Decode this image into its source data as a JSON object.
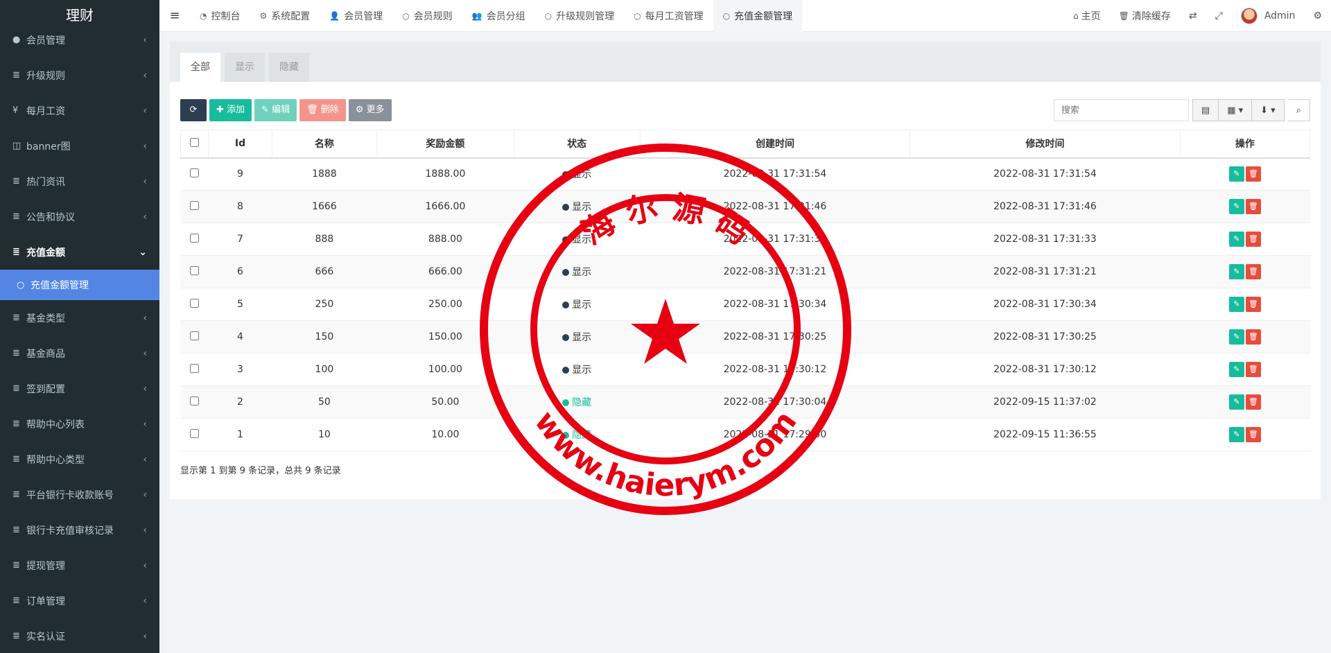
{
  "sidebar": {
    "brand": "理财",
    "items": [
      {
        "icon": "user-circle-icon",
        "glyph": "●",
        "label": "会员管理"
      },
      {
        "icon": "list-icon",
        "glyph": "≣",
        "label": "升级规则"
      },
      {
        "icon": "yen-icon",
        "glyph": "¥",
        "label": "每月工资"
      },
      {
        "icon": "columns-icon",
        "glyph": "◫",
        "label": "banner图"
      },
      {
        "icon": "list-icon",
        "glyph": "≣",
        "label": "热门资讯"
      },
      {
        "icon": "list-icon",
        "glyph": "≣",
        "label": "公告和协议"
      },
      {
        "icon": "list-icon",
        "glyph": "≣",
        "label": "充值金额"
      },
      {
        "icon": "circle-icon",
        "glyph": "○",
        "label": "充值金额管理"
      },
      {
        "icon": "list-icon",
        "glyph": "≣",
        "label": "基金类型"
      },
      {
        "icon": "list-icon",
        "glyph": "≣",
        "label": "基金商品"
      },
      {
        "icon": "list-icon",
        "glyph": "≣",
        "label": "签到配置"
      },
      {
        "icon": "list-icon",
        "glyph": "≣",
        "label": "帮助中心列表"
      },
      {
        "icon": "list-icon",
        "glyph": "≣",
        "label": "帮助中心类型"
      },
      {
        "icon": "list-icon",
        "glyph": "≣",
        "label": "平台银行卡收款账号"
      },
      {
        "icon": "list-icon",
        "glyph": "≣",
        "label": "银行卡充值审核记录"
      },
      {
        "icon": "list-icon",
        "glyph": "≣",
        "label": "提现管理"
      },
      {
        "icon": "list-icon",
        "glyph": "≣",
        "label": "订单管理"
      },
      {
        "icon": "list-icon",
        "glyph": "≣",
        "label": "实名认证"
      }
    ]
  },
  "topnav": {
    "tabs": [
      {
        "icon": "dashboard-icon",
        "label": "控制台"
      },
      {
        "icon": "gear-icon",
        "label": "系统配置"
      },
      {
        "icon": "user-icon",
        "label": "会员管理"
      },
      {
        "icon": "circle-icon",
        "label": "会员规则"
      },
      {
        "icon": "users-icon",
        "label": "会员分组"
      },
      {
        "icon": "circle-icon",
        "label": "升级规则管理"
      },
      {
        "icon": "circle-icon",
        "label": "每月工资管理"
      },
      {
        "icon": "circle-icon",
        "label": "充值金额管理"
      }
    ],
    "right": {
      "home": "主页",
      "clear_cache": "清除缓存",
      "user": "Admin"
    }
  },
  "panel": {
    "filter_tabs": [
      "全部",
      "显示",
      "隐藏"
    ],
    "toolbar": {
      "add": "添加",
      "edit": "编辑",
      "delete": "删除",
      "more": "更多"
    },
    "search_placeholder": "搜索",
    "columns": [
      "Id",
      "名称",
      "奖励金额",
      "状态",
      "创建时间",
      "修改时间",
      "操作"
    ],
    "rows": [
      {
        "id": "9",
        "name": "1888",
        "amount": "1888.00",
        "status": "显示",
        "status_type": "show",
        "created": "2022-08-31 17:31:54",
        "updated": "2022-08-31 17:31:54"
      },
      {
        "id": "8",
        "name": "1666",
        "amount": "1666.00",
        "status": "显示",
        "status_type": "show",
        "created": "2022-08-31 17:31:46",
        "updated": "2022-08-31 17:31:46"
      },
      {
        "id": "7",
        "name": "888",
        "amount": "888.00",
        "status": "显示",
        "status_type": "show",
        "created": "2022-08-31 17:31:33",
        "updated": "2022-08-31 17:31:33"
      },
      {
        "id": "6",
        "name": "666",
        "amount": "666.00",
        "status": "显示",
        "status_type": "show",
        "created": "2022-08-31 17:31:21",
        "updated": "2022-08-31 17:31:21"
      },
      {
        "id": "5",
        "name": "250",
        "amount": "250.00",
        "status": "显示",
        "status_type": "show",
        "created": "2022-08-31 17:30:34",
        "updated": "2022-08-31 17:30:34"
      },
      {
        "id": "4",
        "name": "150",
        "amount": "150.00",
        "status": "显示",
        "status_type": "show",
        "created": "2022-08-31 17:30:25",
        "updated": "2022-08-31 17:30:25"
      },
      {
        "id": "3",
        "name": "100",
        "amount": "100.00",
        "status": "显示",
        "status_type": "show",
        "created": "2022-08-31 17:30:12",
        "updated": "2022-08-31 17:30:12"
      },
      {
        "id": "2",
        "name": "50",
        "amount": "50.00",
        "status": "隐藏",
        "status_type": "hide",
        "created": "2022-08-31 17:30:04",
        "updated": "2022-09-15 11:37:02"
      },
      {
        "id": "1",
        "name": "10",
        "amount": "10.00",
        "status": "隐藏",
        "status_type": "hide",
        "created": "2022-08-31 17:29:50",
        "updated": "2022-09-15 11:36:55"
      }
    ],
    "footer": "显示第 1 到第 9 条记录，总共 9 条记录"
  },
  "watermark": {
    "top_text": "海 尔 源 码",
    "bottom_text": "www.haierym.com",
    "color": "#e60012"
  }
}
